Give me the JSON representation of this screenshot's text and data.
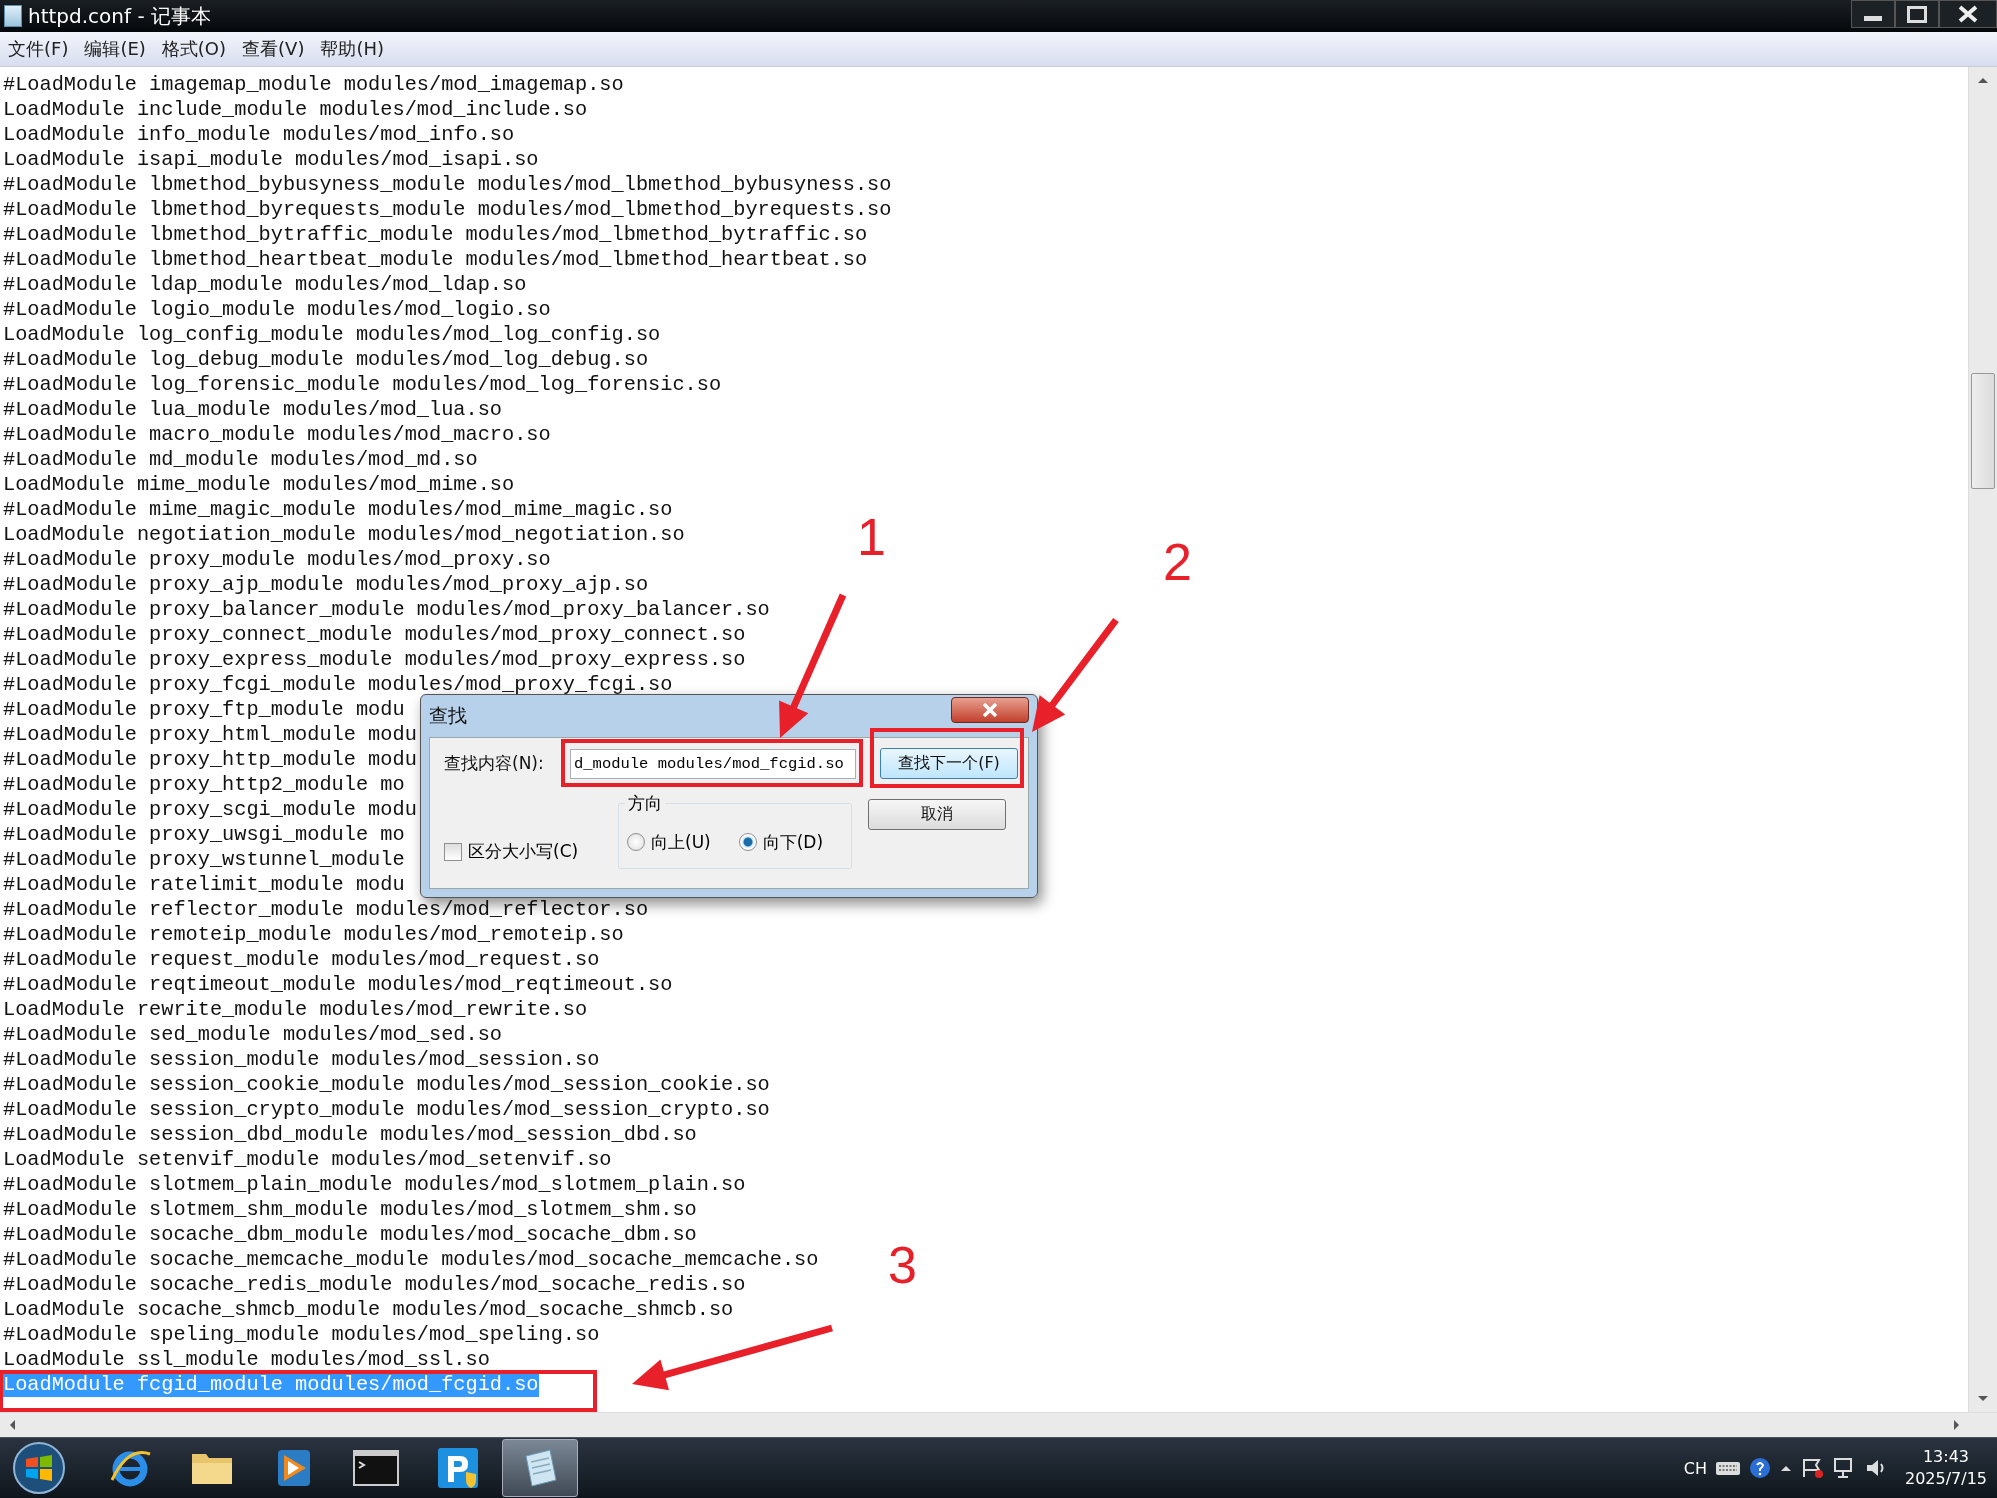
{
  "window": {
    "title": "httpd.conf - 记事本"
  },
  "menu": [
    "文件(F)",
    "编辑(E)",
    "格式(O)",
    "查看(V)",
    "帮助(H)"
  ],
  "lines": [
    {
      "text": "#LoadModule imagemap_module modules/mod_imagemap.so",
      "selected": false
    },
    {
      "text": "LoadModule include_module modules/mod_include.so",
      "selected": false
    },
    {
      "text": "LoadModule info_module modules/mod_info.so",
      "selected": false
    },
    {
      "text": "LoadModule isapi_module modules/mod_isapi.so",
      "selected": false
    },
    {
      "text": "#LoadModule lbmethod_bybusyness_module modules/mod_lbmethod_bybusyness.so",
      "selected": false
    },
    {
      "text": "#LoadModule lbmethod_byrequests_module modules/mod_lbmethod_byrequests.so",
      "selected": false
    },
    {
      "text": "#LoadModule lbmethod_bytraffic_module modules/mod_lbmethod_bytraffic.so",
      "selected": false
    },
    {
      "text": "#LoadModule lbmethod_heartbeat_module modules/mod_lbmethod_heartbeat.so",
      "selected": false
    },
    {
      "text": "#LoadModule ldap_module modules/mod_ldap.so",
      "selected": false
    },
    {
      "text": "#LoadModule logio_module modules/mod_logio.so",
      "selected": false
    },
    {
      "text": "LoadModule log_config_module modules/mod_log_config.so",
      "selected": false
    },
    {
      "text": "#LoadModule log_debug_module modules/mod_log_debug.so",
      "selected": false
    },
    {
      "text": "#LoadModule log_forensic_module modules/mod_log_forensic.so",
      "selected": false
    },
    {
      "text": "#LoadModule lua_module modules/mod_lua.so",
      "selected": false
    },
    {
      "text": "#LoadModule macro_module modules/mod_macro.so",
      "selected": false
    },
    {
      "text": "#LoadModule md_module modules/mod_md.so",
      "selected": false
    },
    {
      "text": "LoadModule mime_module modules/mod_mime.so",
      "selected": false
    },
    {
      "text": "#LoadModule mime_magic_module modules/mod_mime_magic.so",
      "selected": false
    },
    {
      "text": "LoadModule negotiation_module modules/mod_negotiation.so",
      "selected": false
    },
    {
      "text": "#LoadModule proxy_module modules/mod_proxy.so",
      "selected": false
    },
    {
      "text": "#LoadModule proxy_ajp_module modules/mod_proxy_ajp.so",
      "selected": false
    },
    {
      "text": "#LoadModule proxy_balancer_module modules/mod_proxy_balancer.so",
      "selected": false
    },
    {
      "text": "#LoadModule proxy_connect_module modules/mod_proxy_connect.so",
      "selected": false
    },
    {
      "text": "#LoadModule proxy_express_module modules/mod_proxy_express.so",
      "selected": false
    },
    {
      "text": "#LoadModule proxy_fcgi_module modules/mod_proxy_fcgi.so",
      "selected": false
    },
    {
      "text": "#LoadModule proxy_ftp_module modu",
      "selected": false
    },
    {
      "text": "#LoadModule proxy_html_module modu",
      "selected": false
    },
    {
      "text": "#LoadModule proxy_http_module modu",
      "selected": false
    },
    {
      "text": "#LoadModule proxy_http2_module mo",
      "selected": false
    },
    {
      "text": "#LoadModule proxy_scgi_module modu",
      "selected": false
    },
    {
      "text": "#LoadModule proxy_uwsgi_module mo",
      "selected": false
    },
    {
      "text": "#LoadModule proxy_wstunnel_module",
      "selected": false
    },
    {
      "text": "#LoadModule ratelimit_module modu",
      "selected": false
    },
    {
      "text": "#LoadModule reflector_module modules/mod_reflector.so",
      "selected": false
    },
    {
      "text": "#LoadModule remoteip_module modules/mod_remoteip.so",
      "selected": false
    },
    {
      "text": "#LoadModule request_module modules/mod_request.so",
      "selected": false
    },
    {
      "text": "#LoadModule reqtimeout_module modules/mod_reqtimeout.so",
      "selected": false
    },
    {
      "text": "LoadModule rewrite_module modules/mod_rewrite.so",
      "selected": false
    },
    {
      "text": "#LoadModule sed_module modules/mod_sed.so",
      "selected": false
    },
    {
      "text": "#LoadModule session_module modules/mod_session.so",
      "selected": false
    },
    {
      "text": "#LoadModule session_cookie_module modules/mod_session_cookie.so",
      "selected": false
    },
    {
      "text": "#LoadModule session_crypto_module modules/mod_session_crypto.so",
      "selected": false
    },
    {
      "text": "#LoadModule session_dbd_module modules/mod_session_dbd.so",
      "selected": false
    },
    {
      "text": "LoadModule setenvif_module modules/mod_setenvif.so",
      "selected": false
    },
    {
      "text": "#LoadModule slotmem_plain_module modules/mod_slotmem_plain.so",
      "selected": false
    },
    {
      "text": "#LoadModule slotmem_shm_module modules/mod_slotmem_shm.so",
      "selected": false
    },
    {
      "text": "#LoadModule socache_dbm_module modules/mod_socache_dbm.so",
      "selected": false
    },
    {
      "text": "#LoadModule socache_memcache_module modules/mod_socache_memcache.so",
      "selected": false
    },
    {
      "text": "#LoadModule socache_redis_module modules/mod_socache_redis.so",
      "selected": false
    },
    {
      "text": "LoadModule socache_shmcb_module modules/mod_socache_shmcb.so",
      "selected": false
    },
    {
      "text": "#LoadModule speling_module modules/mod_speling.so",
      "selected": false
    },
    {
      "text": "LoadModule ssl_module modules/mod_ssl.so",
      "selected": false
    },
    {
      "text": "LoadModule fcgid_module modules/mod_fcgid.so",
      "selected": true
    }
  ],
  "find_dialog": {
    "title": "查找",
    "find_label": "查找内容(N):",
    "find_value": "d_module modules/mod_fcgid.so",
    "match_case": {
      "label": "区分大小写(C)",
      "checked": false
    },
    "direction": {
      "label": "方向",
      "options": [
        {
          "label": "向上(U)",
          "selected": false
        },
        {
          "label": "向下(D)",
          "selected": true
        }
      ]
    },
    "buttons": [
      "查找下一个(F)",
      "取消"
    ]
  },
  "annotations": [
    "1",
    "2",
    "3"
  ],
  "taskbar": {
    "apps": [
      {
        "kind": "browser",
        "selected": false
      },
      {
        "kind": "folder",
        "selected": false
      },
      {
        "kind": "media",
        "selected": false
      },
      {
        "kind": "terminal",
        "selected": false
      },
      {
        "kind": "p-app",
        "selected": false
      },
      {
        "kind": "notepad",
        "selected": true
      }
    ],
    "language": "CH",
    "time": "13:43",
    "date": "2025/7/15"
  }
}
